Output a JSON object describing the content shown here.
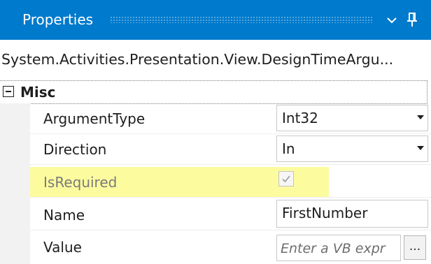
{
  "panel": {
    "title": "Properties",
    "object_type": "System.Activities.Presentation.View.DesignTimeArgu..."
  },
  "category": {
    "label": "Misc",
    "collapse_icon": "minus-box-icon"
  },
  "properties": [
    {
      "name": "ArgumentType",
      "value": "Int32",
      "editor": "dropdown"
    },
    {
      "name": "Direction",
      "value": "In",
      "editor": "dropdown"
    },
    {
      "name": "IsRequired",
      "checked": true,
      "editor": "checkbox",
      "disabled": true
    },
    {
      "name": "Name",
      "value": "FirstNumber",
      "editor": "text"
    },
    {
      "name": "Value",
      "placeholder": "Enter a VB expr",
      "editor": "expression",
      "button_label": "..."
    }
  ],
  "colors": {
    "titlebar": "#007acc",
    "highlight": "#fafa50",
    "gutter": "#f2f2f2"
  },
  "icons": {
    "dropdown": "chevron-down-icon",
    "pin": "pin-icon",
    "checkbox": "checkmark-icon"
  }
}
